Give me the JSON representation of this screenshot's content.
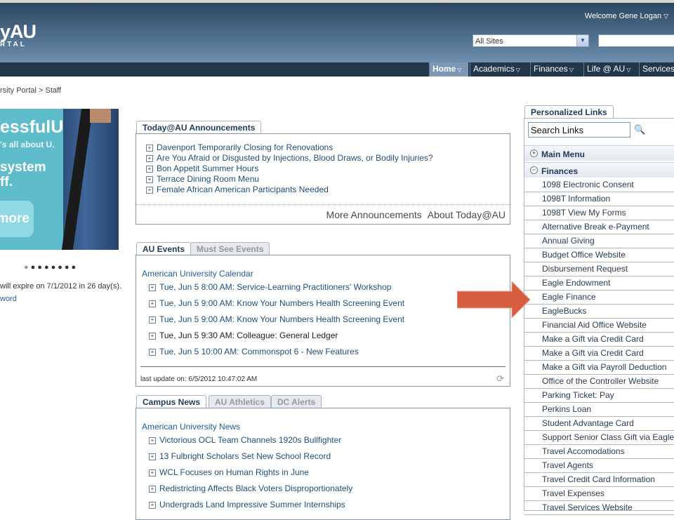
{
  "header": {
    "logo_main": "yAU",
    "logo_sub": "RTAL",
    "welcome": "Welcome Gene Logan",
    "site_select": "All Sites"
  },
  "nav": [
    "Home",
    "Academics",
    "Finances",
    "Life @ AU",
    "Services"
  ],
  "breadcrumb": "rsity Portal > Staff",
  "promo": {
    "line1": "essfulU",
    "line2": "'s all about U.",
    "line3": "system",
    "line4": "ff.",
    "button": "more"
  },
  "left_notice": {
    "expire": "will expire on 7/1/2012 in 26 day(s).",
    "link": "word"
  },
  "announcements": {
    "tab": "Today@AU Announcements",
    "items": [
      "Davenport Temporarily Closing for Renovations",
      "Are You Afraid or Disgusted by Injections, Blood Draws, or Bodily Injuries?",
      "Bon Appetit Summer Hours",
      "Terrace Dining Room Menu",
      "Female African American Participants Needed"
    ],
    "more": "More Announcements",
    "about": "About Today@AU"
  },
  "events": {
    "tabs": [
      "AU Events",
      "Must See Events"
    ],
    "calendar": "American University Calendar",
    "items": [
      "Tue, Jun 5 8:00 AM: Service-Learning Practitioners' Workshop",
      "Tue, Jun 5 9:00 AM: Know Your Numbers Health Screening Event",
      "Tue, Jun 5 9:00 AM: Know Your Numbers Health Screening Event",
      "Tue, Jun 5 9:30 AM: Colleague: General Ledger",
      "Tue, Jun 5 10:00 AM: Commonspot 6 - New Features"
    ],
    "last_update": "last update on: 6/5/2012 10:47:02 AM"
  },
  "news": {
    "tabs": [
      "Campus News",
      "AU Athletics",
      "DC Alerts"
    ],
    "title": "American University News",
    "items": [
      "Victorious OCL Team Channels 1920s Bullfighter",
      "13 Fulbright Scholars Set New School Record",
      "WCL Focuses on Human Rights in June",
      "Redistricting Affects Black Voters Disproportionately",
      "Undergrads Land Impressive Summer Internships"
    ]
  },
  "personalized": {
    "tab": "Personalized Links",
    "search_value": "Search Links",
    "main_menu": "Main Menu",
    "finances": "Finances",
    "items": [
      "1098 Electronic Consent",
      "1098T Information",
      "1098T View My Forms",
      "Alternative Break e-Payment",
      "Annual Giving",
      "Budget Office Website",
      "Disbursement Request",
      "Eagle Endowment",
      "Eagle Finance",
      "EagleBucks",
      "Financial Aid Office Website",
      "Make a Gift via Credit Card",
      "Make a Gift via Credit Card",
      "Make a Gift via Payroll Deduction",
      "Office of the Controller Website",
      "Parking Ticket: Pay",
      "Perkins Loan",
      "Student Advantage Card",
      "Support Senior Class Gift via Eagle",
      "Travel Accomodations",
      "Travel Agents",
      "Travel Credit Card Information",
      "Travel Expenses",
      "Travel Services Website"
    ]
  },
  "colors": {
    "accent_arrow": "#d65d3e",
    "link": "#1f4e7a",
    "navbar": "#23364a"
  }
}
